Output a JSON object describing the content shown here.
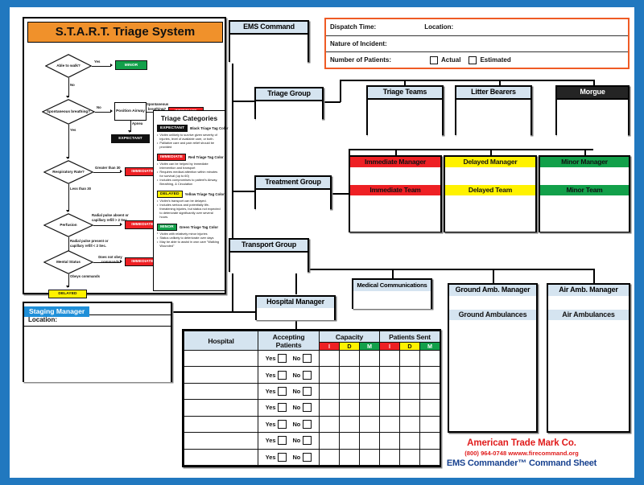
{
  "colors": {
    "page_border": "#2178bf",
    "start_header": "#f0912b",
    "box_header": "#d5e4f0",
    "immediate": "#ee2024",
    "delayed": "#fff200",
    "minor": "#12a04a",
    "expectant": "#111111",
    "staging": "#1f8fd8",
    "form_border": "#ef5b25",
    "brand_red": "#e01b1b",
    "brand_blue": "#17418f"
  },
  "start_panel": {
    "title": "S.T.A.R.T. Triage System",
    "nodes": {
      "able_to_walk": "Able to walk?",
      "spontaneous_breathing": "Spontaneous breathing?",
      "position_airway": "Position Airway",
      "respiratory_rate": "Respiratory Rate?",
      "perfusion": "Perfusion",
      "mental_status": "Mental Status"
    },
    "tags": {
      "minor": "MINOR",
      "immediate": "IMMEDIATE",
      "expectant": "EXPECTANT",
      "delayed": "DELAYED"
    },
    "edges": {
      "yes": "Yes",
      "no": "No",
      "apnea": "Apnea",
      "spontaneous_breathing_q": "Spontaneous breathing?",
      "greater_than_30": "Greater than 30",
      "less_than_30": "Less than 30",
      "radial_absent": "Radial pulse absent or capillary refill > 2 Sec.",
      "radial_present": "Radial pulse present or capillary refill < 2 Sec.",
      "does_not_obey": "Does not obey commands",
      "obeys": "Obeys commands"
    }
  },
  "triage_categories": {
    "title": "Triage Categories",
    "items": [
      {
        "chip": "EXPECTANT",
        "tag_text": "Black Triage Tag Color",
        "bullets": [
          "Victim unlikely to survive given severity of injuries, level of available care, or both.",
          "Palliative care and pain relief should be provided"
        ]
      },
      {
        "chip": "IMMEDIATE",
        "tag_text": "Red Triage Tag Color",
        "bullets": [
          "Victim can be helped by immediate intervention and transport",
          "Requires medical attention within minutes for survival (up to 60)",
          "Includes compromises to patient's Airway, Breathing, & Circulation"
        ]
      },
      {
        "chip": "DELAYED",
        "tag_text": "Yellow Triage Tag Color",
        "bullets": [
          "Victim's transport can be delayed.",
          "Includes serious and potentially life-threatening injuries, but status not expected to deteriorate significantly over several hours."
        ]
      },
      {
        "chip": "MINOR",
        "tag_text": "Green Triage Tag Color",
        "bullets": [
          "Victim with relatively minor injuries",
          "Status unlikely to deteriorate over days",
          "May be able to assist in own care \"Walking Wounded\""
        ]
      }
    ]
  },
  "dispatch_form": {
    "dispatch_time_label": "Dispatch Time:",
    "location_label": "Location:",
    "nature_label": "Nature of Incident:",
    "number_label": "Number of Patients:",
    "actual_label": "Actual",
    "estimated_label": "Estimated"
  },
  "org": {
    "ems_command": "EMS Command",
    "triage_group": "Triage Group",
    "treatment_group": "Treatment Group",
    "transport_group": "Transport Group",
    "triage_teams": "Triage Teams",
    "litter_bearers": "Litter Bearers",
    "morgue": "Morgue",
    "immediate_manager": "Immediate Manager",
    "immediate_team": "Immediate Team",
    "delayed_manager": "Delayed Manager",
    "delayed_team": "Delayed Team",
    "minor_manager": "Minor Manager",
    "minor_team": "Minor Team",
    "hospital_manager": "Hospital Manager",
    "medical_communications": "Medical Communications",
    "ground_amb_manager": "Ground Amb. Manager",
    "ground_ambulances": "Ground Ambulances",
    "air_amb_manager": "Air Amb. Manager",
    "air_ambulances": "Air Ambulances"
  },
  "staging": {
    "title": "Staging Manager",
    "location_label": "Location:"
  },
  "hospital_table": {
    "col_hospital": "Hospital",
    "col_accepting_line1": "Accepting",
    "col_accepting_line2": "Patients",
    "col_capacity": "Capacity",
    "col_patients_sent": "Patients Sent",
    "sub_i": "I",
    "sub_d": "D",
    "sub_m": "M",
    "yes_label": "Yes",
    "no_label": "No",
    "row_count": 7
  },
  "branding": {
    "company": "American Trade Mark Co.",
    "contact": "(800) 964-0748     wwww.firecommand.org",
    "product": "EMS Commander™ Command Sheet"
  }
}
